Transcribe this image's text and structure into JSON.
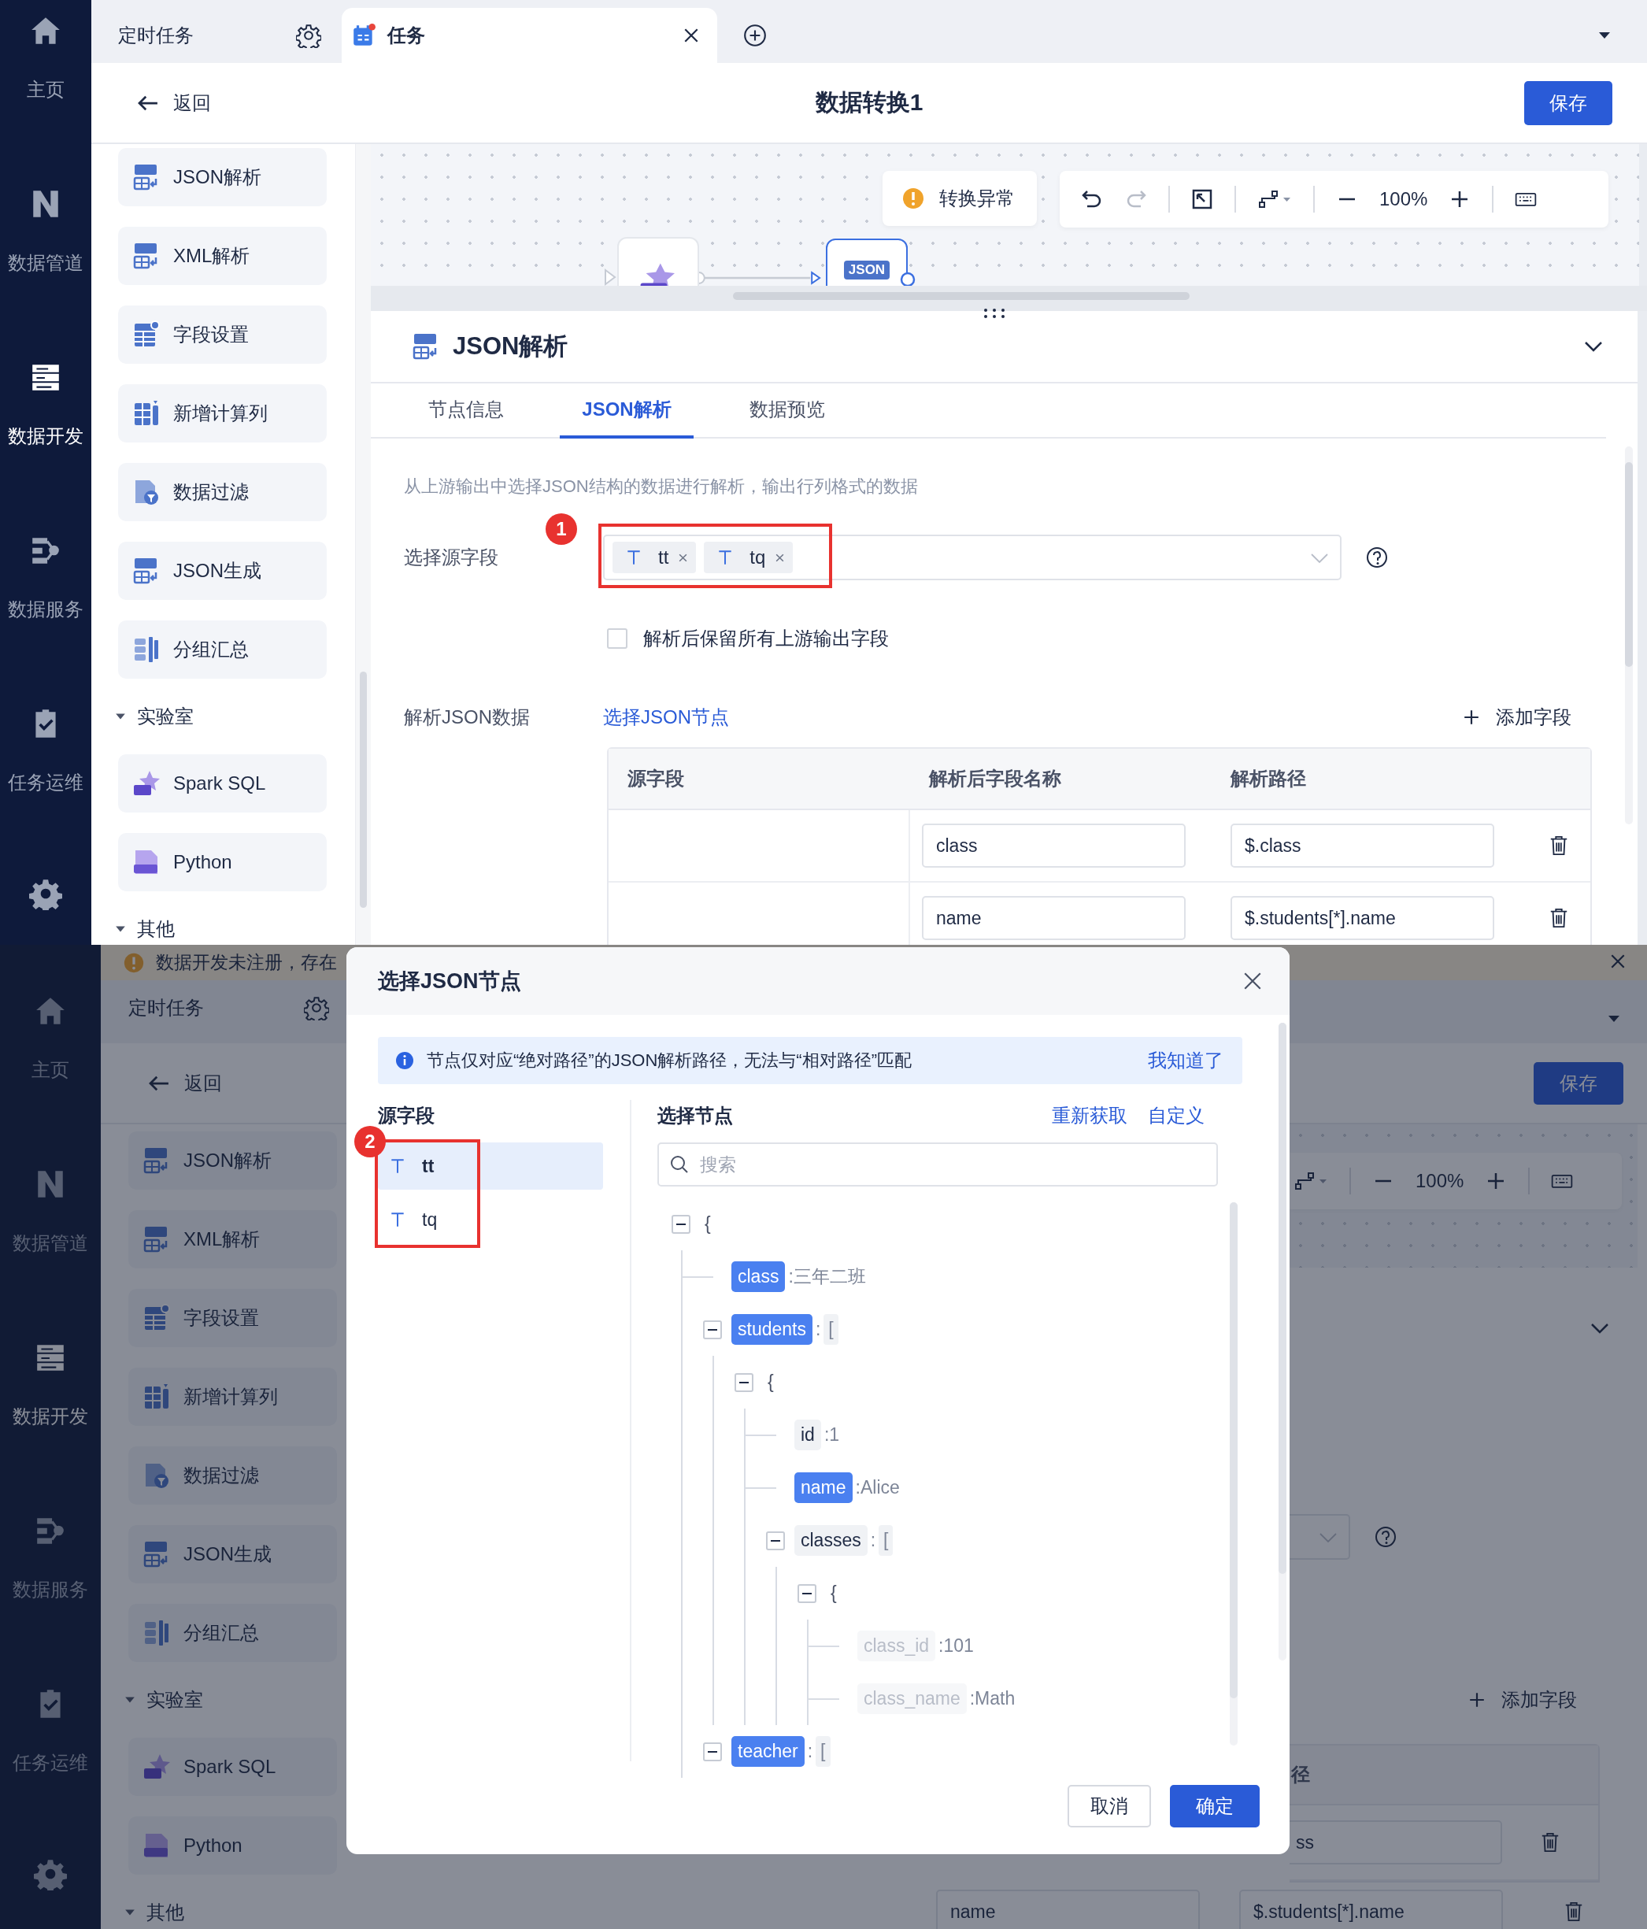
{
  "app": {
    "nav": [
      {
        "label": "主页",
        "selected": false
      },
      {
        "label": "数据管道",
        "selected": false
      },
      {
        "label": "数据开发",
        "selected": true
      },
      {
        "label": "数据服务",
        "selected": false
      },
      {
        "label": "任务运维",
        "selected": false
      }
    ],
    "tabs": [
      {
        "label": "定时任务",
        "selected": false
      },
      {
        "label": "任务",
        "selected": true
      }
    ],
    "back": "返回",
    "title": "数据转换1",
    "save": "保存",
    "sidebar": {
      "items": [
        {
          "kind": "item",
          "label": "JSON解析"
        },
        {
          "kind": "item",
          "label": "XML解析"
        },
        {
          "kind": "item",
          "label": "字段设置"
        },
        {
          "kind": "item",
          "label": "新增计算列"
        },
        {
          "kind": "item",
          "label": "数据过滤"
        },
        {
          "kind": "item",
          "label": "JSON生成"
        },
        {
          "kind": "item",
          "label": "分组汇总"
        },
        {
          "kind": "section",
          "label": "实验室",
          "expanded": true
        },
        {
          "kind": "item",
          "label": "Spark SQL"
        },
        {
          "kind": "item",
          "label": "Python"
        },
        {
          "kind": "section",
          "label": "其他",
          "expanded": true
        }
      ]
    },
    "canvas": {
      "status": "转换异常",
      "zoom": "100%",
      "nodes": [
        {
          "kind": "sql",
          "selected": false
        },
        {
          "kind": "json",
          "badge": "JSON",
          "selected": true
        }
      ]
    },
    "panel": {
      "title": "JSON解析",
      "tabs": [
        {
          "label": "节点信息",
          "selected": false
        },
        {
          "label": "JSON解析",
          "selected": true
        },
        {
          "label": "数据预览",
          "selected": false
        }
      ],
      "description": "从上游输出中选择JSON结构的数据进行解析，输出行列格式的数据",
      "source_label": "选择源字段",
      "source_tags": [
        "tt",
        "tq"
      ],
      "callout": "1",
      "keep_upstream": {
        "label": "解析后保留所有上游输出字段",
        "checked": false
      },
      "parse_label": "解析JSON数据",
      "pick_link": "选择JSON节点",
      "add_field": "添加字段",
      "table": {
        "columns": [
          "源字段",
          "解析后字段名称",
          "解析路径"
        ],
        "rows": [
          {
            "name": "class",
            "path": "$.class"
          },
          {
            "name": "name",
            "path": "$.students[*].name"
          }
        ]
      }
    }
  },
  "background": {
    "banner": "数据开发未注册，存在",
    "nav": [
      {
        "label": "主页",
        "selected": false
      },
      {
        "label": "数据管道",
        "selected": false
      },
      {
        "label": "数据开发",
        "selected": true
      },
      {
        "label": "数据服务",
        "selected": false
      },
      {
        "label": "任务运维",
        "selected": false
      }
    ],
    "tab": "定时任务",
    "back": "返回",
    "save": "保存",
    "sidebar": {
      "items": [
        {
          "kind": "item",
          "label": "JSON解析"
        },
        {
          "kind": "item",
          "label": "XML解析"
        },
        {
          "kind": "item",
          "label": "字段设置"
        },
        {
          "kind": "item",
          "label": "新增计算列"
        },
        {
          "kind": "item",
          "label": "数据过滤"
        },
        {
          "kind": "item",
          "label": "JSON生成"
        },
        {
          "kind": "item",
          "label": "分组汇总"
        },
        {
          "kind": "section",
          "label": "实验室",
          "expanded": true
        },
        {
          "kind": "item",
          "label": "Spark SQL"
        },
        {
          "kind": "item",
          "label": "Python"
        },
        {
          "kind": "section",
          "label": "其他",
          "expanded": true
        }
      ]
    },
    "zoom": "100%",
    "add_field": "添加字段",
    "column_fragment": "径",
    "rows": [
      {
        "path": "ss"
      },
      {
        "name": "name",
        "path": "$.students[*].name"
      }
    ]
  },
  "dialog": {
    "title": "选择JSON节点",
    "notice": "节点仅对应“绝对路径”的JSON解析路径，无法与“相对路径”匹配",
    "dismiss": "我知道了",
    "source_heading": "源字段",
    "callout": "2",
    "fields": [
      {
        "name": "tt",
        "selected": true
      },
      {
        "name": "tq",
        "selected": false
      }
    ],
    "node_heading": "选择节点",
    "refetch": "重新获取",
    "custom": "自定义",
    "search": {
      "placeholder": "搜索"
    },
    "tree": {
      "bracket": "{",
      "expanded": true,
      "children": [
        {
          "key": "class",
          "value": ":三年二班",
          "selected": true,
          "disabled": false
        },
        {
          "key": "students",
          "sep": ":",
          "bracket": "[",
          "selected": true,
          "disabled": false,
          "expanded": true,
          "children": [
            {
              "bracket": "{",
              "expanded": true,
              "children": [
                {
                  "key": "id",
                  "value": ":1",
                  "selected": false,
                  "disabled": false
                },
                {
                  "key": "name",
                  "value": ":Alice",
                  "selected": true,
                  "disabled": false
                },
                {
                  "key": "classes",
                  "sep": ":",
                  "bracket": "[",
                  "selected": false,
                  "disabled": false,
                  "expanded": true,
                  "children": [
                    {
                      "bracket": "{",
                      "expanded": true,
                      "children": [
                        {
                          "key": "class_id",
                          "value": ":101",
                          "selected": false,
                          "disabled": true
                        },
                        {
                          "key": "class_name",
                          "value": ":Math",
                          "selected": false,
                          "disabled": true
                        }
                      ]
                    }
                  ]
                }
              ]
            }
          ]
        },
        {
          "key": "teacher",
          "sep": ":",
          "bracket": "[",
          "selected": true,
          "disabled": false,
          "expanded": true
        }
      ]
    },
    "buttons": {
      "cancel": "取消",
      "ok": "确定"
    }
  }
}
